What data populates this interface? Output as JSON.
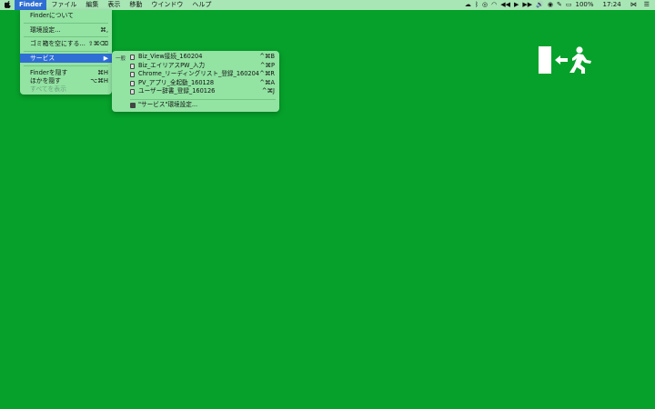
{
  "menubar": {
    "apple_icon": "apple-logo",
    "items": [
      "Finder",
      "ファイル",
      "編集",
      "表示",
      "移動",
      "ウインドウ",
      "ヘルプ"
    ],
    "active_index": 0,
    "status": {
      "battery": "100%",
      "time": "17:24"
    }
  },
  "finder_menu": {
    "items": [
      {
        "label": "Finderについて",
        "shortcut": ""
      },
      {
        "label": "環境設定...",
        "shortcut": "⌘,"
      },
      {
        "label": "ゴミ箱を空にする...",
        "shortcut": "⇧⌘⌫"
      },
      {
        "label": "サービス",
        "shortcut": "▶"
      },
      {
        "label": "Finderを隠す",
        "shortcut": "⌘H"
      },
      {
        "label": "ほかを隠す",
        "shortcut": "⌥⌘H"
      },
      {
        "label": "すべてを表示",
        "shortcut": ""
      }
    ]
  },
  "services_menu": {
    "category": "一般",
    "items": [
      {
        "label": "Biz_View接続_160204",
        "shortcut": "^⌘B"
      },
      {
        "label": "Biz_エイリアスPW_入力",
        "shortcut": "^⌘P"
      },
      {
        "label": "Chrome_リーディングリスト_登録_160204",
        "shortcut": "^⌘R"
      },
      {
        "label": "PV_アプリ_全起動_160128",
        "shortcut": "^⌘A"
      },
      {
        "label": "ユーザー辞書_登録_160126",
        "shortcut": "^⌘J"
      }
    ],
    "prefs_label": "\"サービス\"環境設定..."
  },
  "icons": {
    "exit_sign": "emergency-exit-icon"
  },
  "colors": {
    "desktop": "#06a12b",
    "menu_bg": "#93e3a3",
    "menubar_bg": "#a8e7b5",
    "selection": "#2f6fd4"
  }
}
